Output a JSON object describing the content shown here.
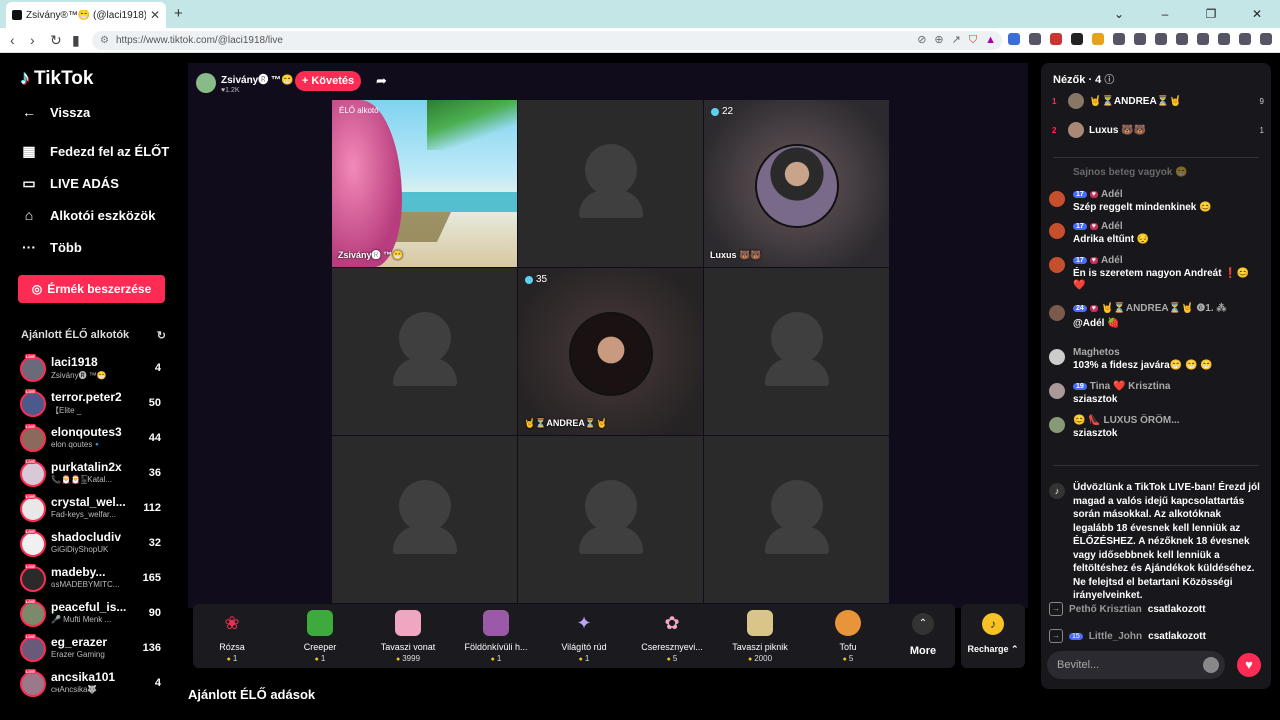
{
  "browser": {
    "tab_title": "Zsivány®™😁 (@laci1918) É...",
    "url": "https://www.tiktok.com/@laci1918/live"
  },
  "sidebar": {
    "brand": "TikTok",
    "back": "Vissza",
    "items": [
      {
        "label": "Fedezd fel az ÉLŐT",
        "icon": "calendar-icon"
      },
      {
        "label": "LIVE ADÁS",
        "icon": "video-icon"
      },
      {
        "label": "Alkotói eszközök",
        "icon": "creator-tools-icon"
      },
      {
        "label": "Több",
        "icon": "more-icon"
      }
    ],
    "coins_button": "Érmék beszerzése",
    "suggested_header": "Ajánlott ÉLŐ alkotók",
    "creators": [
      {
        "name": "laci1918",
        "sub": "Zsivány🅡 ™😁",
        "count": "4"
      },
      {
        "name": "terror.peter2",
        "sub": "【Elite _",
        "count": "50"
      },
      {
        "name": "elonqoutes3",
        "sub": "elon qoutes🔹",
        "count": "44"
      },
      {
        "name": "purkatalin2x",
        "sub": "📞🎅🎅🀩Katal...",
        "count": "36"
      },
      {
        "name": "crystal_wel...",
        "sub": "Fad-keys_welfar...",
        "count": "112"
      },
      {
        "name": "shadocludiv",
        "sub": "GiGiDiyShopUK",
        "count": "32"
      },
      {
        "name": "madeby...",
        "sub": "ɢsMADEBYMITC...",
        "count": "165"
      },
      {
        "name": "peaceful_is...",
        "sub": "🎤 Mufti Menk ...",
        "count": "90"
      },
      {
        "name": "eg_erazer",
        "sub": "Erazer Gaming",
        "count": "136"
      },
      {
        "name": "ancsika101",
        "sub": "cнAncsika🐺",
        "count": "4"
      }
    ]
  },
  "stream": {
    "host_name": "Zsivány🅡 ™😁",
    "host_likes": "♥1.2K",
    "follow_label": "+ Követés",
    "cells": [
      {
        "badge": "ÉLŐ alkotó",
        "caption": "Zsivány🅡 ™😁"
      },
      {
        "badge": "",
        "caption": ""
      },
      {
        "badge": "22",
        "caption": "Luxus 🐻🐻"
      },
      {
        "badge": "",
        "caption": ""
      },
      {
        "badge": "35",
        "caption": "🤘⏳ANDREA⏳🤘"
      },
      {
        "badge": "",
        "caption": ""
      },
      {
        "badge": "",
        "caption": ""
      },
      {
        "badge": "",
        "caption": ""
      },
      {
        "badge": "",
        "caption": ""
      }
    ]
  },
  "gifts": [
    {
      "name": "Rózsa",
      "price": "1",
      "icon": "rose-icon"
    },
    {
      "name": "Creeper",
      "price": "1",
      "icon": "creeper-icon"
    },
    {
      "name": "Tavaszi vonat",
      "price": "3999",
      "icon": "train-icon"
    },
    {
      "name": "Földönkívüli h...",
      "price": "1",
      "icon": "alien-icon"
    },
    {
      "name": "Világító rúd",
      "price": "1",
      "icon": "glow-stick-icon"
    },
    {
      "name": "Cseresznyevi...",
      "price": "5",
      "icon": "cherry-blossom-icon"
    },
    {
      "name": "Tavaszi piknik",
      "price": "2000",
      "icon": "picnic-icon"
    },
    {
      "name": "Tofu",
      "price": "5",
      "icon": "tofu-icon"
    }
  ],
  "more_label": "More",
  "recharge_label": "Recharge ⌃",
  "suggested_live": "Ajánlott ÉLŐ adások",
  "chat": {
    "viewers_header": "Nézők · 4",
    "viewers": [
      {
        "rank": "1",
        "name": "🤘⏳ANDREA⏳🤘",
        "score": "9"
      },
      {
        "rank": "2",
        "name": "Luxus 🐻🐻",
        "score": "1"
      }
    ],
    "faded_msg": "Sajnos beteg vagyok 😁",
    "messages": [
      {
        "level": "17",
        "user": "Adél",
        "text": "Szép reggelt mindenkinek 😊"
      },
      {
        "level": "17",
        "user": "Adél",
        "text": "Adrika eltűnt 😔"
      },
      {
        "level": "17",
        "user": "Adél",
        "text": "Én is szeretem nagyon Andreát ❗😊 ❤️"
      },
      {
        "level": "24",
        "user": "🤘⏳ANDREA⏳🤘 ❻1. ⁂",
        "text": "@Adél 🍓"
      },
      {
        "level": "",
        "user": "Maghetos",
        "text": "103% a fidesz javára😁 😁 😁"
      },
      {
        "level": "19",
        "user": "Tina ❤️ Krisztina",
        "text": "sziasztok"
      },
      {
        "level": "",
        "user": "😊 👠 LUXUS ÖRÖM...",
        "text": "sziasztok"
      }
    ],
    "welcome": "Üdvözlünk a TikTok LIVE-ban! Érezd jól magad a valós idejű kapcsolattartás során másokkal. Az alkotóknak legalább 18 évesnek kell lenniük az ÉLŐZÉSHEZ. A nézőknek 18 évesnek vagy idősebbnek kell lenniük a feltöltéshez és Ajándékok küldéséhez. Ne felejtsd el betartani Közösségi irányelveinket.",
    "joins": [
      {
        "level": "",
        "user": "Pethő Krisztian",
        "text": "csatlakozott"
      },
      {
        "level": "15",
        "user": "Little_John",
        "text": "csatlakozott"
      }
    ],
    "input_placeholder": "Bevitel..."
  }
}
